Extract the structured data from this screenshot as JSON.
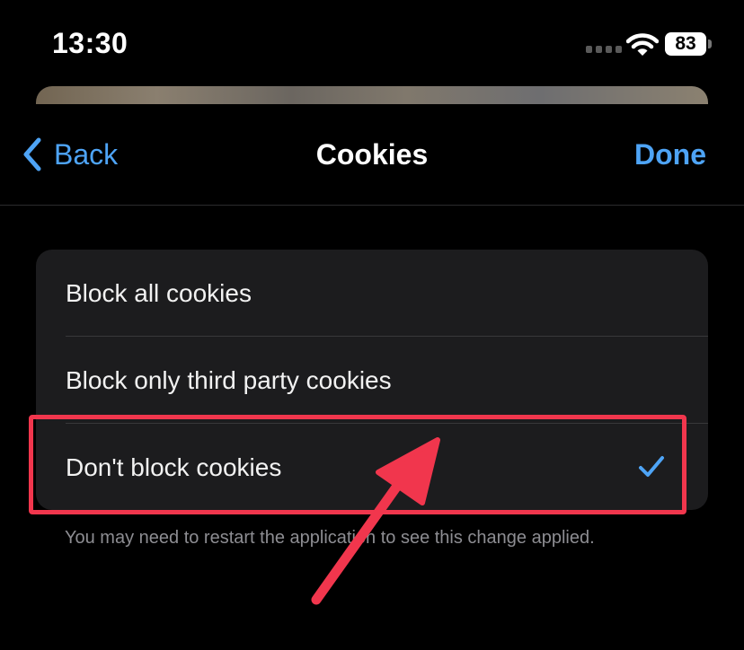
{
  "status_bar": {
    "time": "13:30",
    "battery_level": "83"
  },
  "nav": {
    "back_label": "Back",
    "title": "Cookies",
    "done_label": "Done"
  },
  "options": [
    {
      "label": "Block all cookies",
      "selected": false
    },
    {
      "label": "Block only third party cookies",
      "selected": false
    },
    {
      "label": "Don't block cookies",
      "selected": true
    }
  ],
  "footnote": "You may need to restart the application to see this change applied.",
  "colors": {
    "accent": "#4ea4f6",
    "highlight": "#f1364d",
    "card_background": "#1c1c1e",
    "page_background": "#000000"
  },
  "icons": {
    "back": "chevron-left-icon",
    "selected": "checkmark-icon",
    "wifi": "wifi-icon",
    "signal": "cellular-signal-icon",
    "battery": "battery-icon"
  }
}
